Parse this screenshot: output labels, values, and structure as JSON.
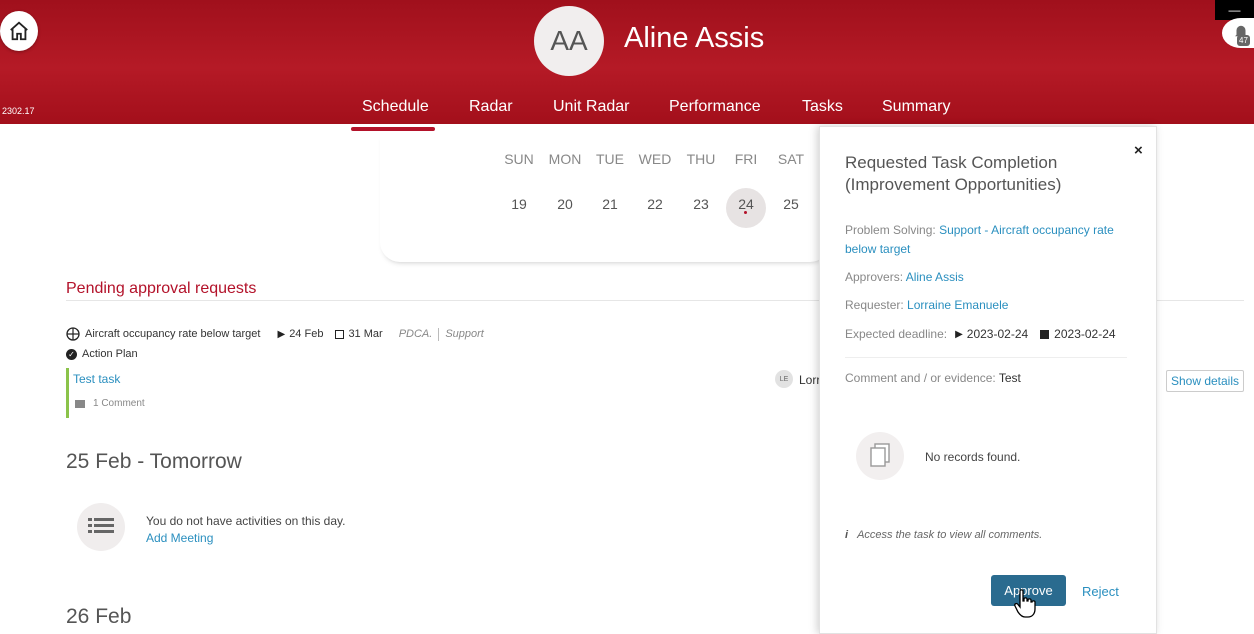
{
  "header": {
    "version": "2302.17",
    "avatar_initials": "AA",
    "user_name": "Aline Assis",
    "window_control": "—",
    "notification_count": "47"
  },
  "nav": {
    "items": [
      "Schedule",
      "Radar",
      "Unit Radar",
      "Performance",
      "Tasks",
      "Summary"
    ],
    "active": "Schedule"
  },
  "calendar": {
    "days": [
      "SUN",
      "MON",
      "TUE",
      "WED",
      "THU",
      "FRI",
      "SAT"
    ],
    "dates": [
      "19",
      "20",
      "21",
      "22",
      "23",
      "24",
      "25"
    ],
    "selected": "24"
  },
  "pending": {
    "title": "Pending approval requests",
    "item": {
      "name": "Aircraft occupancy rate below target",
      "start": "24 Feb",
      "end": "31 Mar",
      "method": "PDCA.",
      "category": "Support",
      "type": "Action Plan",
      "task": "Test task",
      "comments": "1 Comment",
      "requester_initials": "LE",
      "requester_partial": "Lorr",
      "show_details": "Show details"
    }
  },
  "days": [
    {
      "heading": "25 Feb - Tomorrow",
      "empty_text": "You do not have activities on this day.",
      "add_link": "Add Meeting"
    },
    {
      "heading": "26 Feb"
    }
  ],
  "panel": {
    "title": "Requested Task Completion (Improvement Opportunities)",
    "problem_label": "Problem Solving:",
    "problem_value": "Support - Aircraft occupancy rate below target",
    "approvers_label": "Approvers:",
    "approvers_value": "Aline Assis",
    "requester_label": "Requester:",
    "requester_value": "Lorraine Emanuele",
    "deadline_label": "Expected deadline:",
    "deadline_start": "2023-02-24",
    "deadline_end": "2023-02-24",
    "comment_label": "Comment and / or evidence:",
    "comment_value": "Test",
    "no_records": "No records found.",
    "info_note": "Access the task to view all comments.",
    "approve": "Approve",
    "reject": "Reject",
    "close": "×"
  },
  "colors": {
    "header": "#a8141f",
    "accent": "#b3122a",
    "link": "#2a8fbf",
    "approve_button": "#2a6b8f",
    "green_bar": "#8bc34a"
  }
}
